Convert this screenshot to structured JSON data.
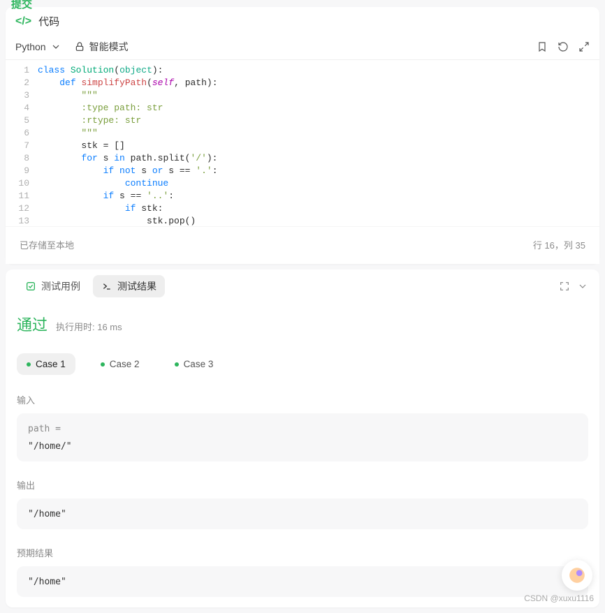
{
  "topbar": {
    "submit_label": "提交"
  },
  "code_header": {
    "icon_label": "</>",
    "title": "代码"
  },
  "toolbar": {
    "language": "Python",
    "mode": "智能模式"
  },
  "editor": {
    "lines": [
      {
        "n": 1
      },
      {
        "n": 2
      },
      {
        "n": 3
      },
      {
        "n": 4
      },
      {
        "n": 5
      },
      {
        "n": 6
      },
      {
        "n": 7
      },
      {
        "n": 8
      },
      {
        "n": 9
      },
      {
        "n": 10
      },
      {
        "n": 11
      },
      {
        "n": 12
      },
      {
        "n": 13
      }
    ]
  },
  "statusbar": {
    "saved": "已存储至本地",
    "position": "行 16，列 35"
  },
  "results": {
    "tab_cases": "测试用例",
    "tab_results": "测试结果",
    "pass_title": "通过",
    "runtime_label": "执行用时: 16 ms",
    "cases": [
      {
        "label": "Case 1",
        "active": true
      },
      {
        "label": "Case 2",
        "active": false
      },
      {
        "label": "Case 3",
        "active": false
      }
    ],
    "input_label": "输入",
    "input_param": "path =",
    "input_value": "\"/home/\"",
    "output_label": "输出",
    "output_value": "\"/home\"",
    "expected_label": "预期结果",
    "expected_value": "\"/home\""
  },
  "watermark": "CSDN @xuxu1116"
}
